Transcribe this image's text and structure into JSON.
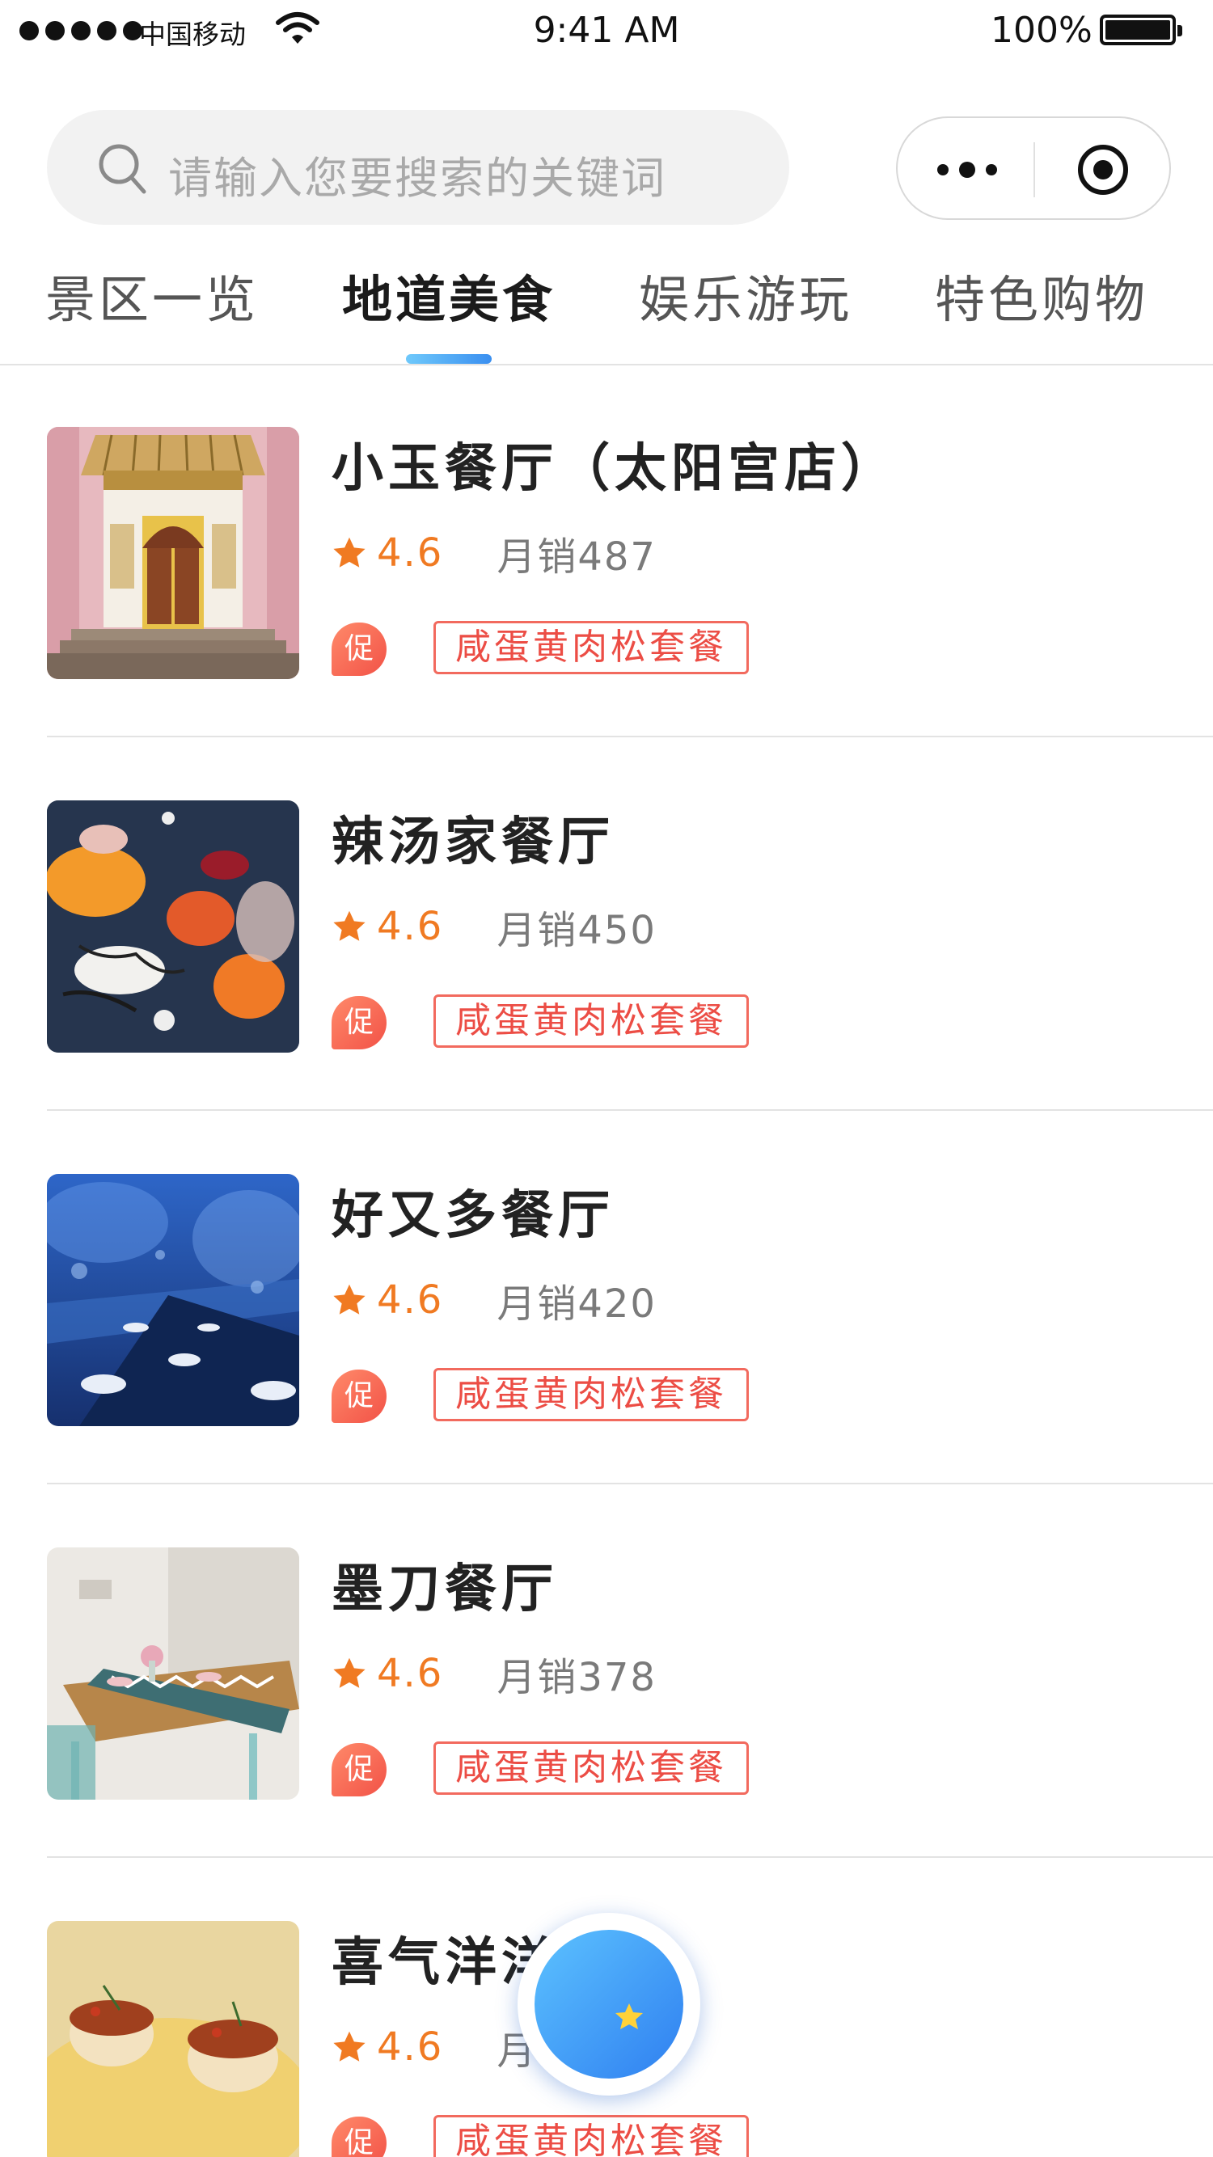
{
  "status_bar": {
    "carrier": "中国移动",
    "time": "9:41 AM",
    "battery": "100%"
  },
  "search": {
    "placeholder": "请输入您要搜索的关键词"
  },
  "tabs": [
    {
      "label": "景区一览",
      "active": false
    },
    {
      "label": "地道美食",
      "active": true
    },
    {
      "label": "娱乐游玩",
      "active": false
    },
    {
      "label": "特色购物",
      "active": false
    }
  ],
  "restaurants": [
    {
      "name": "小玉餐厅（太阳宫店）",
      "rating": "4.6",
      "sales": "月销487",
      "promo_badge": "促",
      "promo": "咸蛋黄肉松套餐"
    },
    {
      "name": "辣汤家餐厅",
      "rating": "4.6",
      "sales": "月销450",
      "promo_badge": "促",
      "promo": "咸蛋黄肉松套餐"
    },
    {
      "name": "好又多餐厅",
      "rating": "4.6",
      "sales": "月销420",
      "promo_badge": "促",
      "promo": "咸蛋黄肉松套餐"
    },
    {
      "name": "墨刀餐厅",
      "rating": "4.6",
      "sales": "月销378",
      "promo_badge": "促",
      "promo": "咸蛋黄肉松套餐"
    },
    {
      "name": "喜气洋洋",
      "rating": "4.6",
      "sales": "月销",
      "promo_badge": "促",
      "promo": "咸蛋黄肉松套餐"
    }
  ],
  "colors": {
    "accent_blue": "#3a8ff0",
    "rating_orange": "#f07a22",
    "promo_red": "#ec4d45"
  },
  "icons": [
    "signal-dots-icon",
    "wifi-icon",
    "battery-icon",
    "search-icon",
    "more-icon",
    "close-miniprogram-icon",
    "star-icon",
    "planet-icon"
  ]
}
